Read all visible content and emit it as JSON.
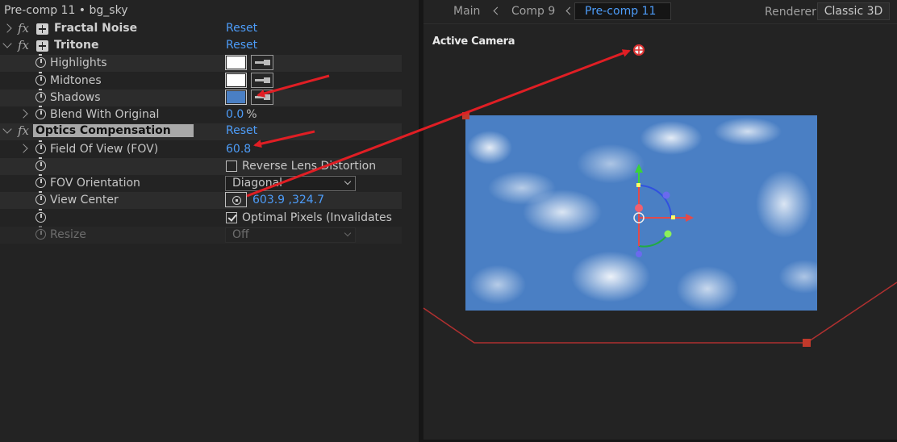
{
  "effect_controls": {
    "title": "Pre-comp 11 • bg_sky",
    "effects": [
      {
        "name": "Fractal Noise",
        "reset": "Reset"
      },
      {
        "name": "Tritone",
        "reset": "Reset"
      }
    ],
    "tritone_params": [
      {
        "label": "Highlights",
        "color": "#ffffff"
      },
      {
        "label": "Midtones",
        "color": "#ffffff"
      },
      {
        "label": "Shadows",
        "color": "#4a7fc4"
      }
    ],
    "blend": {
      "label": "Blend With Original",
      "value": "0.0",
      "unit": "%"
    },
    "optics": {
      "name": "Optics Compensation",
      "reset": "Reset",
      "fov_label": "Field Of View (FOV)",
      "fov_value": "60.8",
      "reverse_label": "Reverse Lens Distortion",
      "orientation_label": "FOV Orientation",
      "orientation_value": "Diagonal",
      "view_center_label": "View Center",
      "view_center_x": "603.9",
      "view_center_y": ",324.7",
      "optimal_label": "Optimal Pixels (Invalidates",
      "resize_label": "Resize",
      "resize_value": "Off"
    }
  },
  "viewer": {
    "breadcrumbs": [
      "Main",
      "Comp 9",
      "Pre-comp 11"
    ],
    "renderer_label": "Renderer:",
    "renderer_value": "Classic 3D",
    "camera_label": "Active Camera"
  },
  "colors": {
    "accent": "#4d9cf8",
    "annotation_arrow": "#e01e24",
    "sky": "#4a7fc4"
  }
}
